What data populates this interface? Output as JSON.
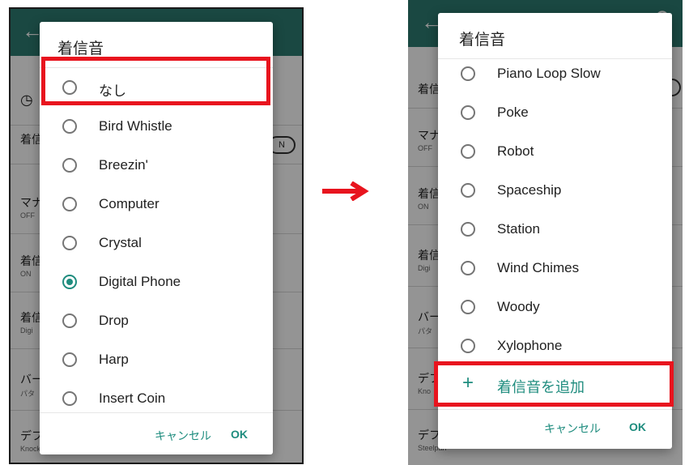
{
  "left": {
    "background": {
      "rows": [
        {
          "title": "",
          "subtitle": ""
        },
        {
          "title": "着信",
          "subtitle": ""
        },
        {
          "title": "マナ",
          "subtitle": "OFF"
        },
        {
          "title": "着信",
          "subtitle": "ON"
        },
        {
          "title": "着信",
          "subtitle": "Digi"
        },
        {
          "title": "バー",
          "subtitle": "パタ"
        },
        {
          "title": "デフ",
          "subtitle": "Knock"
        }
      ],
      "toggle_label": "N"
    },
    "dialog": {
      "title": "着信音",
      "options": [
        "なし",
        "Bird Whistle",
        "Breezin'",
        "Computer",
        "Crystal",
        "Digital Phone",
        "Drop",
        "Harp",
        "Insert Coin"
      ],
      "selected_option": "Digital Phone",
      "cancel_label": "キャンセル",
      "ok_label": "OK"
    }
  },
  "right": {
    "background": {
      "rows": [
        {
          "title": "着信",
          "subtitle": ""
        },
        {
          "title": "マナ",
          "subtitle": "OFF"
        },
        {
          "title": "着信",
          "subtitle": "ON"
        },
        {
          "title": "着信",
          "subtitle": "Digi"
        },
        {
          "title": "バー",
          "subtitle": "パタ"
        },
        {
          "title": "デフ",
          "subtitle": "Kno"
        },
        {
          "title": "デフ",
          "subtitle": "Steelpan"
        }
      ],
      "toggle_label": "N)"
    },
    "dialog": {
      "title": "着信音",
      "options": [
        "Piano Loop Slow",
        "Poke",
        "Robot",
        "Spaceship",
        "Station",
        "Wind Chimes",
        "Woody",
        "Xylophone"
      ],
      "add_label": "着信音を追加",
      "cancel_label": "キャンセル",
      "ok_label": "OK"
    }
  },
  "colors": {
    "accent": "#1e8c7e",
    "highlight": "#e8141e",
    "appbar": "#2e7d73"
  }
}
